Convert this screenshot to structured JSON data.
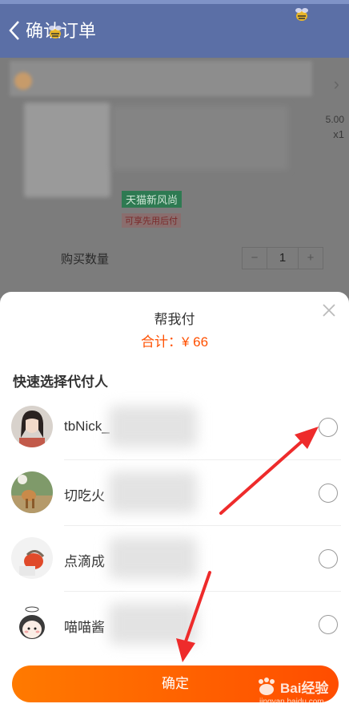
{
  "nav": {
    "title": "确认订单"
  },
  "order": {
    "price": "5.00",
    "qty": "x1",
    "tag_green": "天猫新风尚",
    "tag_pay": "可享先用后付",
    "qty_label": "购买数量",
    "stepper": {
      "minus": "−",
      "value": "1",
      "plus": "+"
    }
  },
  "sheet": {
    "title": "帮我付",
    "total": "合计：¥ 66",
    "section": "快速选择代付人",
    "payers": [
      {
        "name": "tbNick_"
      },
      {
        "name": "切吃火"
      },
      {
        "name": "点滴成"
      },
      {
        "name": "喵喵酱"
      }
    ],
    "confirm": "确定"
  },
  "watermark": {
    "text": "Bai经验",
    "sub": "jingyan.baidu.com"
  },
  "colors": {
    "accent": "#ff5000",
    "nav": "#5b6fa6",
    "annotation": "#ee2b2b"
  }
}
